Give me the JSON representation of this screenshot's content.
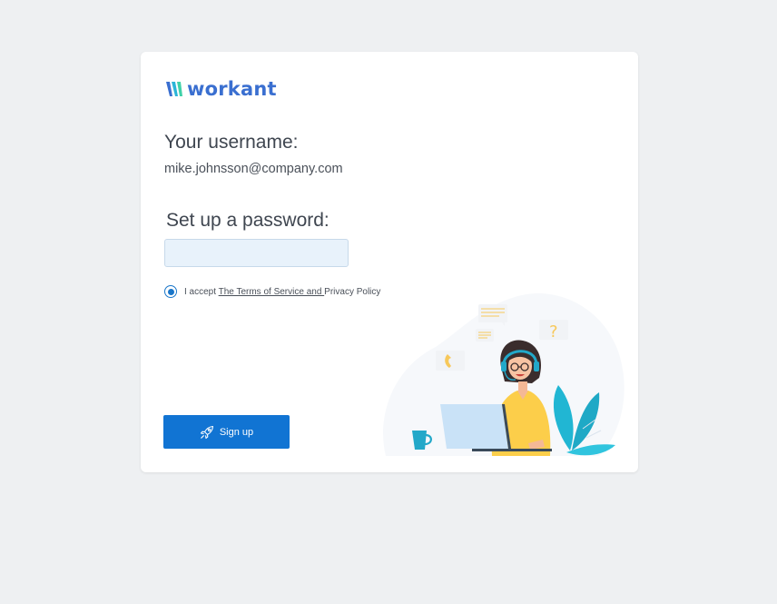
{
  "brand": {
    "name": "workant",
    "color": "#3a6fd0"
  },
  "username": {
    "heading": "Your username:",
    "value": "mike.johnsson@company.com"
  },
  "password": {
    "heading": "Set up a password:",
    "value": "",
    "placeholder": ""
  },
  "terms": {
    "prefix": "I accept ",
    "terms_link": "The Terms of Service and ",
    "privacy_link": "Privacy Policy",
    "accepted": true
  },
  "signup": {
    "label": "Sign up",
    "icon": "rocket-icon",
    "color": "#1174d3"
  },
  "illustration": {
    "name": "support-agent-illustration"
  }
}
